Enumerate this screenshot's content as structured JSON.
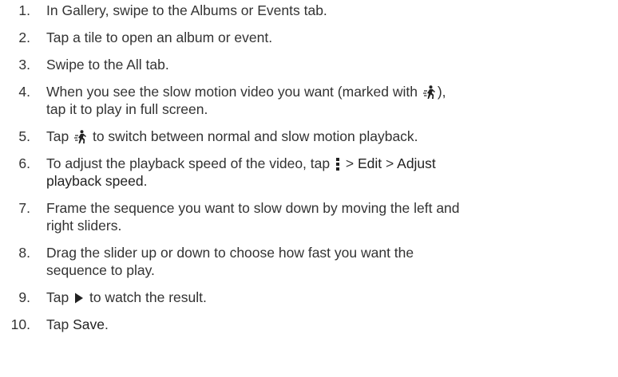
{
  "steps": [
    {
      "num": "1.",
      "text": "In Gallery, swipe to the Albums or Events tab."
    },
    {
      "num": "2.",
      "text": "Tap a tile to open an album or event."
    },
    {
      "num": "3.",
      "text": "Swipe to the All tab."
    },
    {
      "num": "4.",
      "a": "When you see the slow motion video you want (marked with",
      "b": "),",
      "c": "tap it to play in full screen.",
      "icon": "slow-motion-icon"
    },
    {
      "num": "5.",
      "a": "Tap",
      "b": "to switch between normal and slow motion playback.",
      "icon": "slow-motion-icon"
    },
    {
      "num": "6.",
      "a": "To adjust the playback speed of the video, tap",
      "b": ">",
      "kw1": "Edit",
      "c": ">",
      "kw2": "Adjust",
      "kw3": "playback speed",
      "d": ".",
      "icon": "more-vertical-icon"
    },
    {
      "num": "7.",
      "text": "Frame the sequence you want to slow down by moving the left and right sliders."
    },
    {
      "num": "8.",
      "text": "Drag the slider up or down to choose how fast you want the sequence to play."
    },
    {
      "num": "9.",
      "a": "Tap",
      "b": "to watch the result.",
      "icon": "play-icon"
    },
    {
      "num": "10.",
      "a": "Tap",
      "kw": "Save",
      "b": "."
    }
  ]
}
